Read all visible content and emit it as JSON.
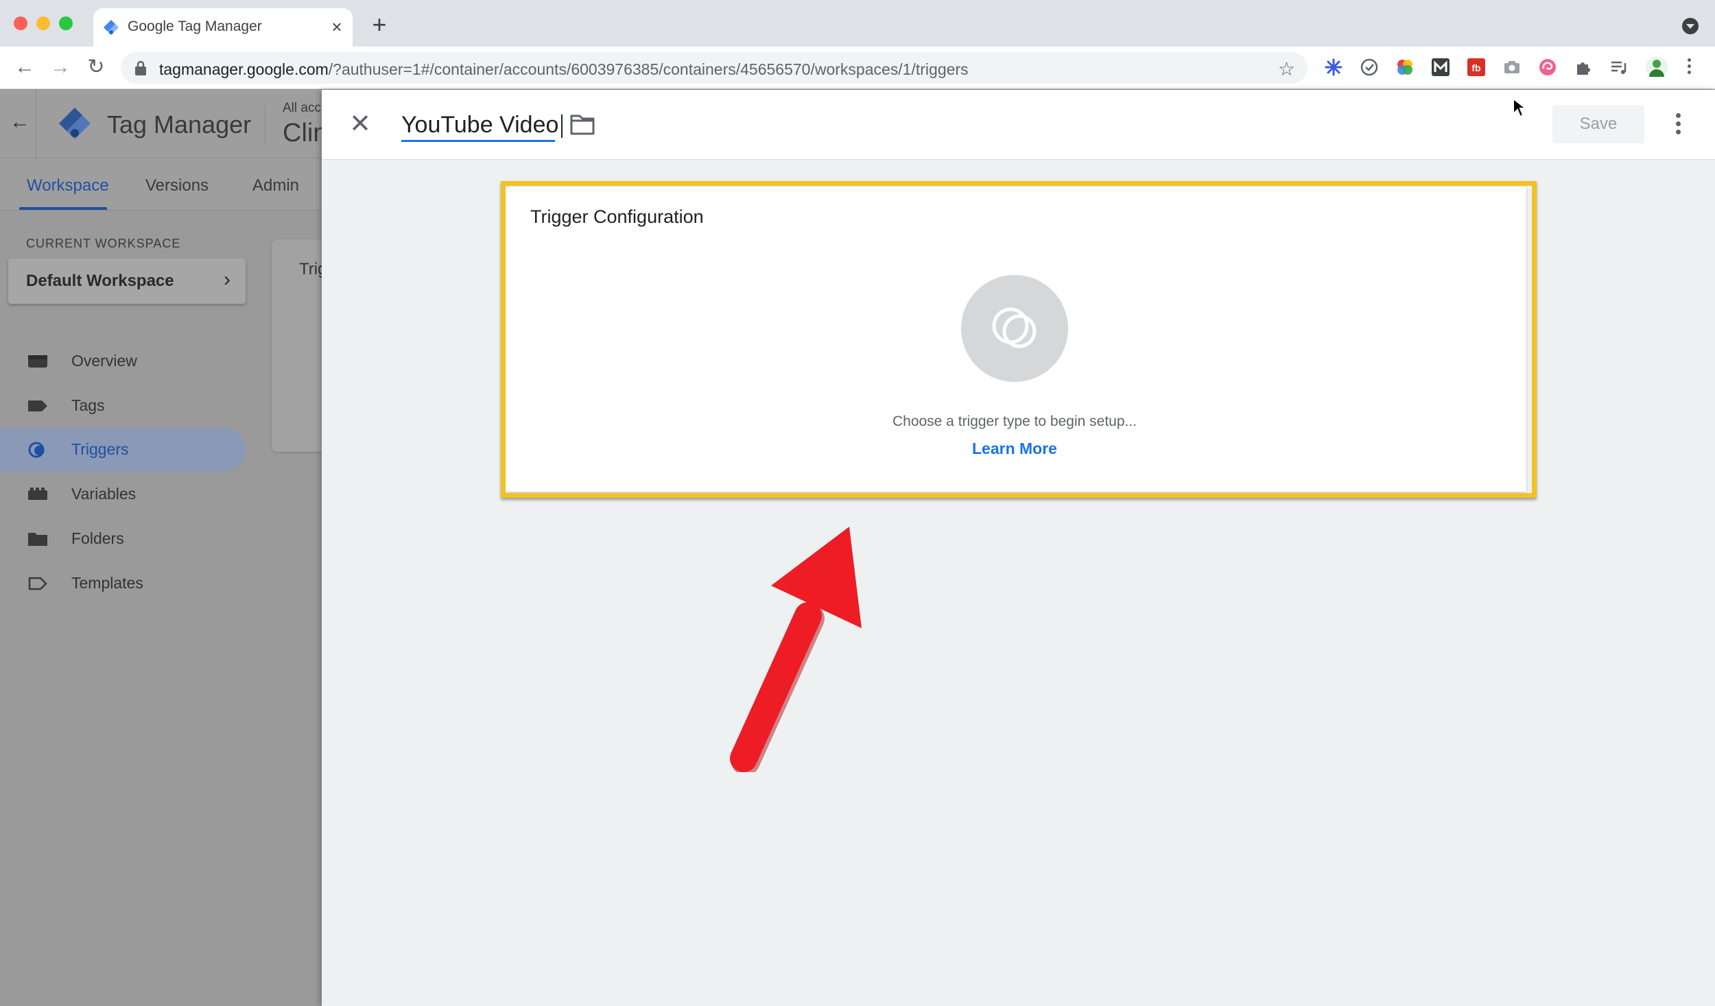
{
  "browser": {
    "tab_title": "Google Tag Manager",
    "tab_close": "×",
    "new_tab": "+",
    "url_host": "tagmanager.google.com",
    "url_path": "/?authuser=1#/container/accounts/6003976385/containers/45656570/workspaces/1/triggers",
    "extensions": [
      "asterisk-extension-icon",
      "check-extension-icon",
      "color-wheel-extension-icon",
      "m-extension-icon",
      "fb-extension-icon",
      "camera-extension-icon",
      "swirl-extension-icon",
      "puzzle-extension-icon",
      "reading-list-icon",
      "profile-avatar"
    ]
  },
  "gtm": {
    "brand": "Tag Manager",
    "account_label": "All acc",
    "container_name": "Clin",
    "nav_tabs": [
      {
        "label": "Workspace",
        "active": true
      },
      {
        "label": "Versions",
        "active": false
      },
      {
        "label": "Admin",
        "active": false
      }
    ],
    "current_workspace_label": "CURRENT WORKSPACE",
    "workspace_name": "Default Workspace",
    "sidebar": [
      {
        "label": "Overview",
        "icon": "overview-icon"
      },
      {
        "label": "Tags",
        "icon": "tag-icon"
      },
      {
        "label": "Triggers",
        "icon": "trigger-icon",
        "active": true
      },
      {
        "label": "Variables",
        "icon": "variables-icon"
      },
      {
        "label": "Folders",
        "icon": "folder-icon"
      },
      {
        "label": "Templates",
        "icon": "template-icon"
      }
    ],
    "background_card_text": "Trig"
  },
  "panel": {
    "name": "YouTube Video",
    "save_label": "Save",
    "config": {
      "title": "Trigger Configuration",
      "hint": "Choose a trigger type to begin setup...",
      "learn_more": "Learn More"
    }
  },
  "colors": {
    "accent_blue": "#1a73e8",
    "highlight_yellow": "#f2c225",
    "arrow_red": "#ee1c25"
  }
}
